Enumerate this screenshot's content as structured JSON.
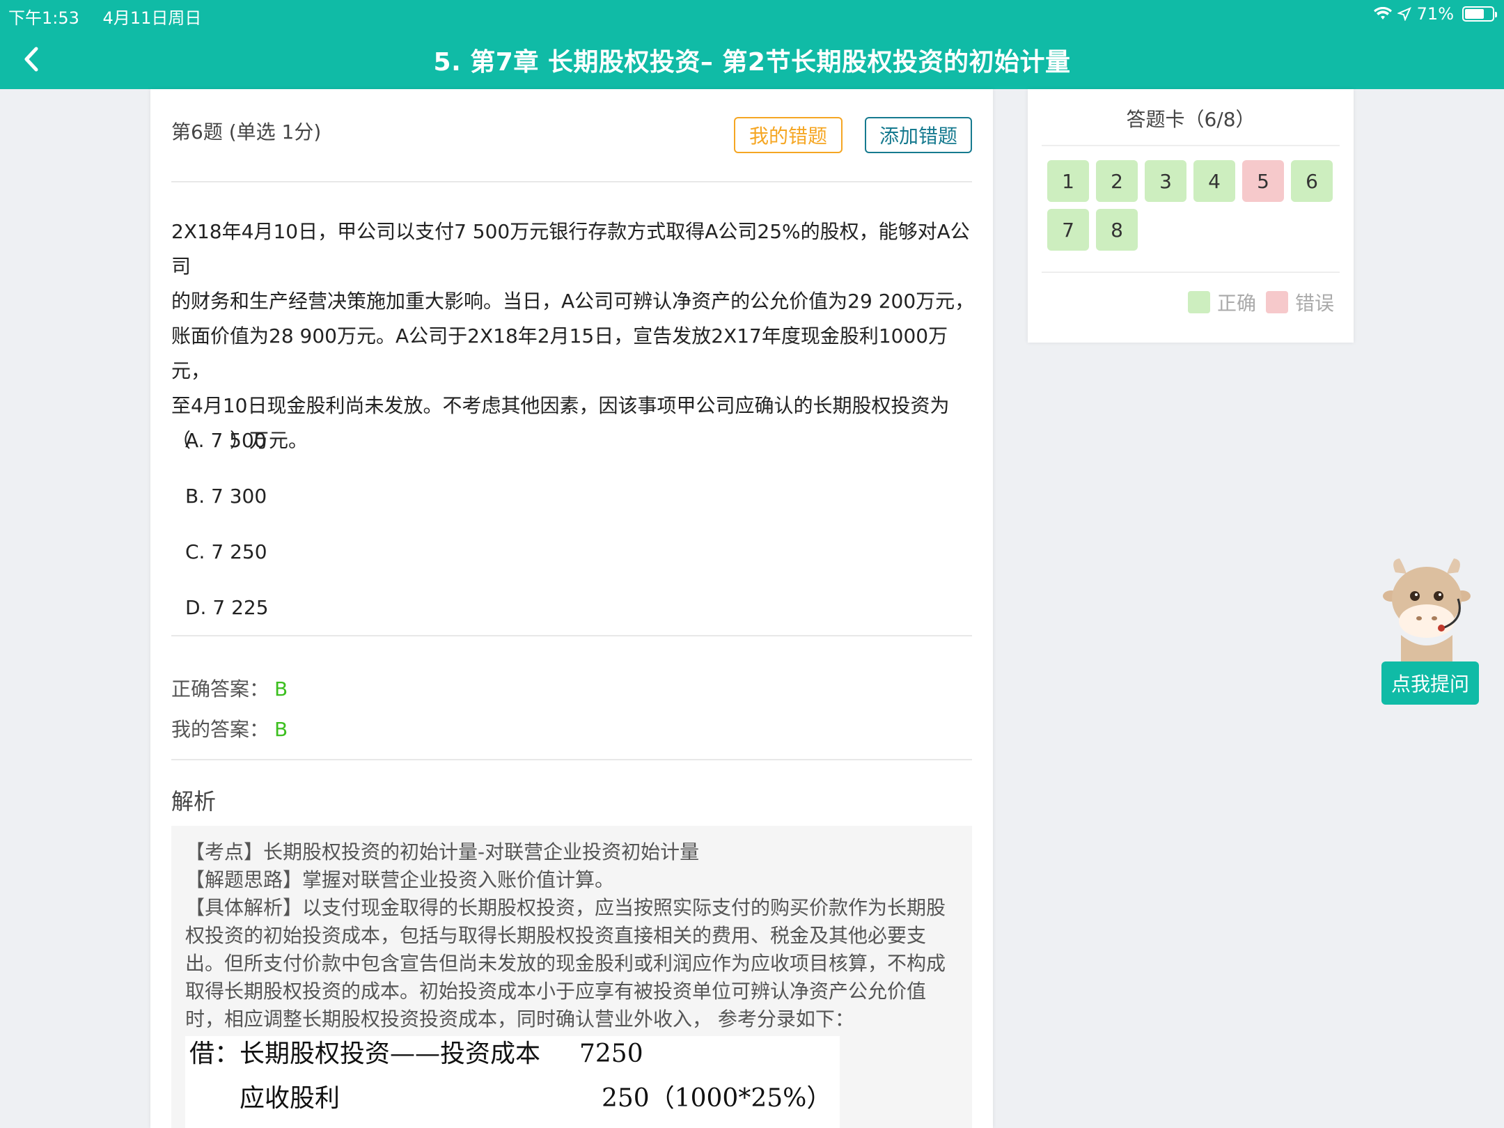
{
  "status_bar": {
    "time": "下午1:53",
    "date": "4月11日周日",
    "battery": "71%",
    "battery_level": 0.71
  },
  "header": {
    "title": "5. 第7章 长期股权投资– 第2节长期股权投资的初始计量"
  },
  "question": {
    "head": "第6题 (单选  1分)",
    "my_mistakes_label": "我的错题",
    "add_mistake_label": "添加错题",
    "stem_lines": [
      "2X18年4月10日，甲公司以支付7 500万元银行存款方式取得A公司25%的股权，能够对A公司",
      "的财务和生产经营决策施加重大影响。当日，A公司可辨认净资产的公允价值为29 200万元，",
      "账面价值为28 900万元。A公司于2X18年2月15日，宣告发放2X17年度现金股利1000万元，",
      "至4月10日现金股利尚未发放。不考虑其他因素，因该事项甲公司应确认的长期股权投资为",
      "（　　）万元。"
    ],
    "options": [
      "A. 7 500",
      "B. 7 300",
      "C. 7 250",
      "D. 7 225"
    ],
    "correct_label": "正确答案：",
    "correct_value": "B",
    "my_label": "我的答案：",
    "my_value": "B"
  },
  "analysis": {
    "title": "解析",
    "lines": [
      "【考点】长期股权投资的初始计量-对联营企业投资初始计量",
      "【解题思路】掌握对联营企业投资入账价值计算。",
      "【具体解析】以支付现金取得的长期股权投资，应当按照实际支付的购买价款作为长期股",
      "权投资的初始投资成本，包括与取得长期股权投资直接相关的费用、税金及其他必要支",
      "出。但所支付价款中包含宣告但尚未发放的现金股利或利润应作为应收项目核算，不构成",
      "取得长期股权投资的成本。初始投资成本小于应享有被投资单位可辨认净资产公允价值",
      "时，相应调整长期股权投资投资成本，同时确认营业外收入，  参考分录如下："
    ],
    "journal": {
      "row1_label": "借：长期股权投资——投资成本",
      "row1_value": "7250",
      "row2_label": "应收股利",
      "row2_value": "250（1000*25%）"
    }
  },
  "answer_sheet": {
    "title": "答题卡（6/8）",
    "cells": [
      {
        "label": "1",
        "status": "correct"
      },
      {
        "label": "2",
        "status": "correct"
      },
      {
        "label": "3",
        "status": "correct"
      },
      {
        "label": "4",
        "status": "correct"
      },
      {
        "label": "5",
        "status": "wrong"
      },
      {
        "label": "6",
        "status": "correct"
      },
      {
        "label": "7",
        "status": "correct"
      },
      {
        "label": "8",
        "status": "correct"
      }
    ],
    "legend_correct": "正确",
    "legend_wrong": "错误"
  },
  "assistant": {
    "ask_label": "点我提问"
  },
  "colors": {
    "brand": "#10bba6",
    "correct": "#cdeebf",
    "wrong": "#f6c9cb",
    "answer_green": "#3cbf1f",
    "orange": "#f5a623",
    "teal_dark": "#167a8f"
  }
}
